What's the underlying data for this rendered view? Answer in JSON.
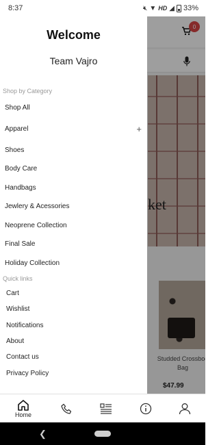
{
  "status": {
    "time": "8:37",
    "network": "HD",
    "battery": "33%"
  },
  "drawer": {
    "title": "Welcome",
    "subtitle": "Team Vajro",
    "category_heading": "Shop by Category",
    "categories": [
      {
        "label": "Shop All"
      },
      {
        "label": "Apparel",
        "expandable": true
      },
      {
        "label": "Shoes"
      },
      {
        "label": "Body Care"
      },
      {
        "label": "Handbags"
      },
      {
        "label": "Jewlery & Acessories"
      },
      {
        "label": "Neoprene Collection"
      },
      {
        "label": "Final Sale"
      },
      {
        "label": "Holiday Collection"
      }
    ],
    "quicklinks_heading": "Quick links",
    "quicklinks": [
      {
        "label": "Cart"
      },
      {
        "label": "Wishlist"
      },
      {
        "label": "Notifications"
      },
      {
        "label": "About"
      },
      {
        "label": "Contact us"
      },
      {
        "label": "Privacy Policy"
      }
    ]
  },
  "background": {
    "cart_count": "0",
    "hero_text": "ket",
    "product_name": "Studded Crossbod Bag",
    "product_price": "$47.99"
  },
  "tabbar": {
    "home_label": "Home",
    "icons": [
      "home-icon",
      "phone-icon",
      "list-icon",
      "info-icon",
      "profile-icon"
    ]
  },
  "colors": {
    "badge": "#d84545",
    "overlay": "rgba(0,0,0,0.38)"
  }
}
